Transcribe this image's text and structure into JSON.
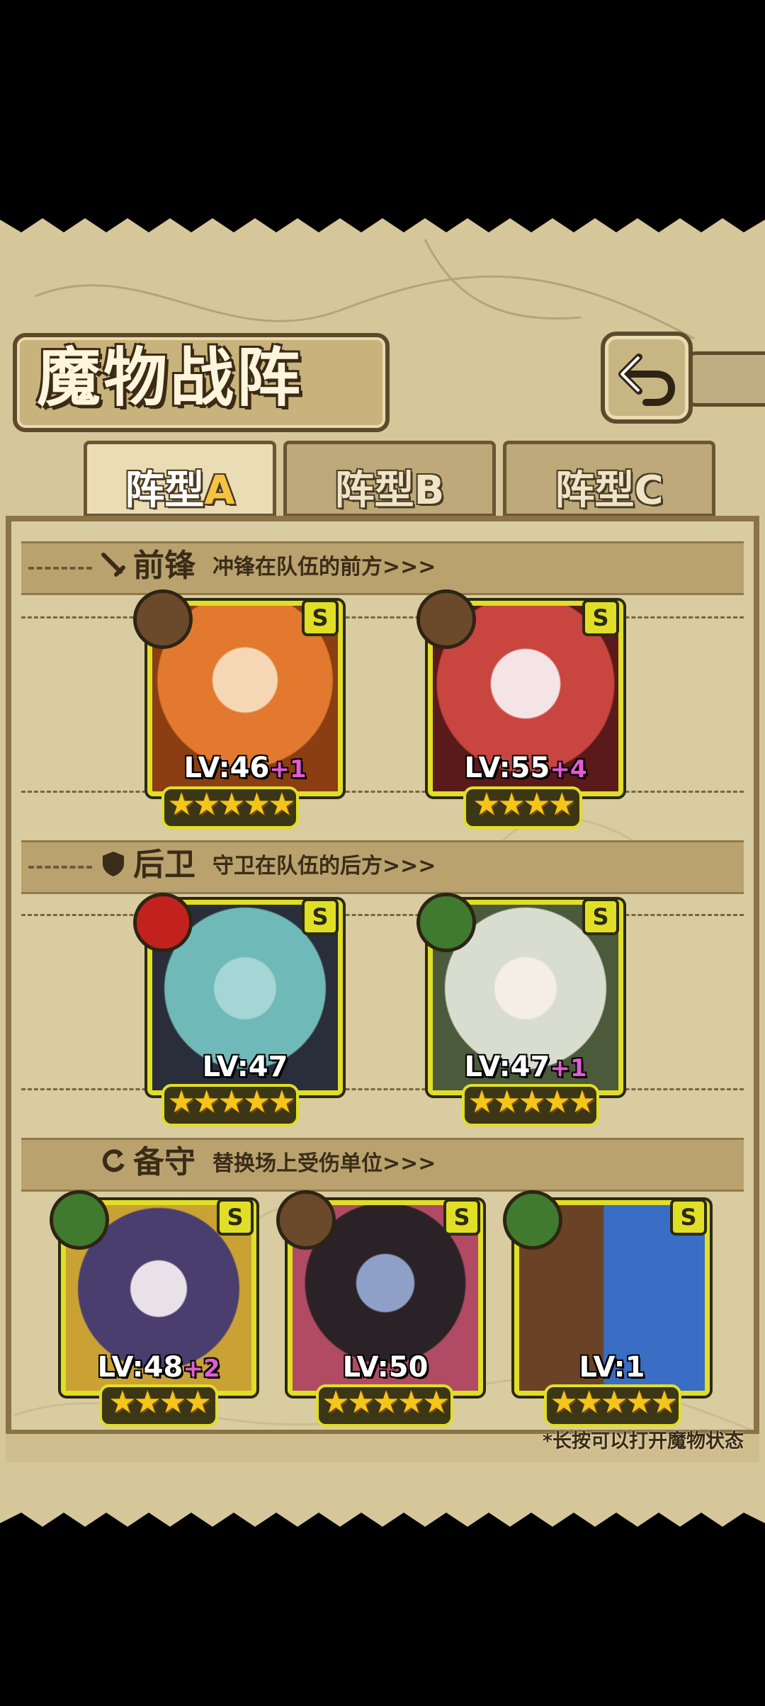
{
  "header": {
    "title": "魔物战阵",
    "back_icon": "return-arrow-icon"
  },
  "tabs": [
    {
      "prefix": "阵型",
      "letter": "A",
      "active": true
    },
    {
      "prefix": "阵型",
      "letter": "B",
      "active": false
    },
    {
      "prefix": "阵型",
      "letter": "C",
      "active": false
    }
  ],
  "sections": {
    "front": {
      "title": "前锋",
      "subtitle": "冲锋在队伍的前方>>>",
      "icon": "sword-icon"
    },
    "rear": {
      "title": "后卫",
      "subtitle": "守卫在队伍的后方>>>",
      "icon": "shield-icon"
    },
    "reserve": {
      "title": "备守",
      "subtitle": "替换场上受伤单位>>>",
      "icon": "swap-icon"
    }
  },
  "cards": [
    {
      "lv": "LV:46",
      "plus": "+1",
      "stars": "★★★★★",
      "rank": "S",
      "element": "earth",
      "elem_color": "#6b4a2b",
      "art": "#e2792e"
    },
    {
      "lv": "LV:55",
      "plus": "+4",
      "stars": "★★★★",
      "rank": "S",
      "element": "earth",
      "elem_color": "#6b4a2b",
      "art": "#c9453f"
    },
    {
      "lv": "LV:47",
      "plus": "",
      "stars": "★★★★★",
      "rank": "S",
      "element": "fire",
      "elem_color": "#c2221d",
      "art": "#6fb9b8"
    },
    {
      "lv": "LV:47",
      "plus": "+1",
      "stars": "★★★★★",
      "rank": "S",
      "element": "wood",
      "elem_color": "#3f7a2e",
      "art": "#d9ddd0"
    },
    {
      "lv": "LV:48",
      "plus": "+2",
      "stars": "★★★★",
      "rank": "S",
      "element": "wood",
      "elem_color": "#3f7a2e",
      "art": "#4a3e6e"
    },
    {
      "lv": "LV:50",
      "plus": "",
      "stars": "★★★★★",
      "rank": "S",
      "element": "earth",
      "elem_color": "#6b4a2b",
      "art": "#b04b63"
    },
    {
      "lv": "LV:1",
      "plus": "",
      "stars": "★★★★★",
      "rank": "S",
      "element": "wood",
      "elem_color": "#3f7a2e",
      "art": "#3a6dc4"
    }
  ],
  "hint": "*长按可以打开魔物状态"
}
